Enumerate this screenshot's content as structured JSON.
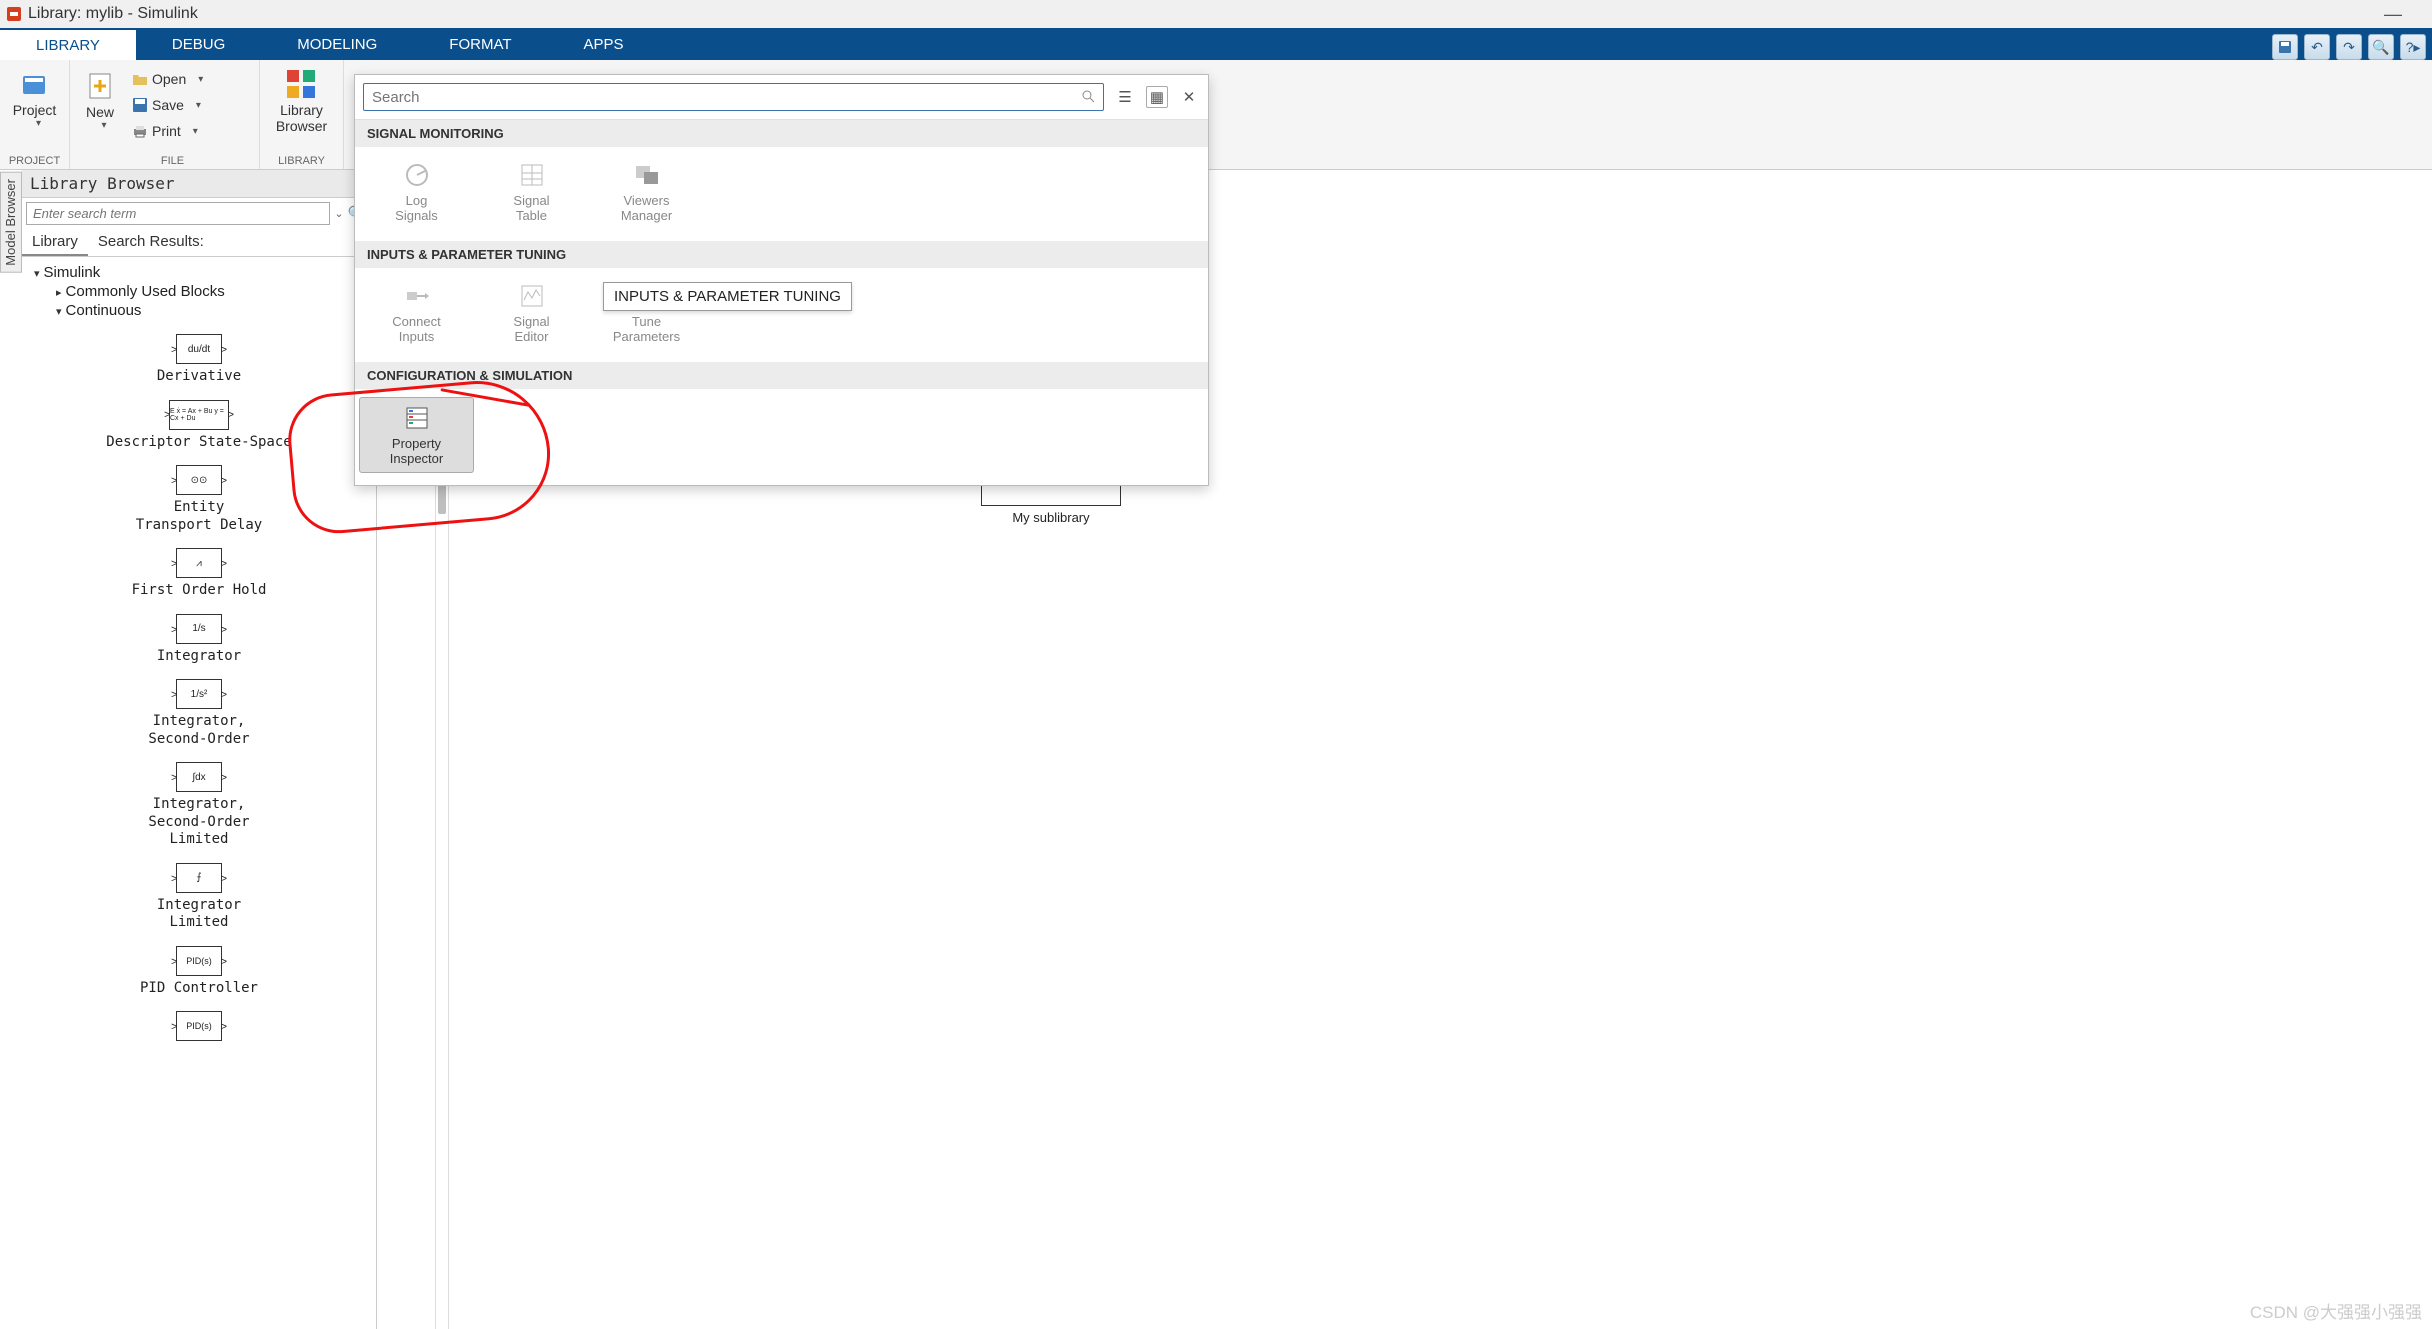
{
  "window": {
    "title": "Library: mylib - Simulink"
  },
  "tabs": [
    {
      "label": "LIBRARY",
      "active": true
    },
    {
      "label": "DEBUG",
      "active": false
    },
    {
      "label": "MODELING",
      "active": false
    },
    {
      "label": "FORMAT",
      "active": false
    },
    {
      "label": "APPS",
      "active": false
    }
  ],
  "ribbon": {
    "project": {
      "label": "Project",
      "group": "PROJECT"
    },
    "new": {
      "label": "New"
    },
    "open": {
      "label": "Open"
    },
    "save": {
      "label": "Save"
    },
    "print": {
      "label": "Print"
    },
    "file_group": "FILE",
    "library_browser": {
      "l1": "Library",
      "l2": "Browser",
      "group": "LIBRARY"
    }
  },
  "model_browser_tab": "Model Browser",
  "lib_browser": {
    "title": "Library Browser",
    "search_placeholder": "Enter search term",
    "tabs": {
      "library": "Library",
      "results": "Search Results:"
    },
    "tree": {
      "root": "Simulink",
      "n1": "Commonly Used Blocks",
      "n2": "Continuous"
    },
    "blocks": [
      {
        "icon": "du/dt",
        "label": "Derivative"
      },
      {
        "icon": "E ẋ = Ax + Bu\ny = Cx + Du",
        "label": "Descriptor State-Space"
      },
      {
        "icon": "⊙⊙",
        "label": "Entity\nTransport Delay"
      },
      {
        "icon": "⩘",
        "label": "First Order Hold"
      },
      {
        "icon": "1/s",
        "label": "Integrator"
      },
      {
        "icon": "1/s²",
        "label": "Integrator,\nSecond-Order"
      },
      {
        "icon": "∫dx",
        "label": "Integrator,\nSecond-Order\nLimited"
      },
      {
        "icon": "⨍",
        "label": "Integrator\nLimited"
      },
      {
        "icon": "PID(s)",
        "label": "PID Controller"
      },
      {
        "icon": "PID(s)",
        "label": ""
      }
    ]
  },
  "apps_dropdown": {
    "search_placeholder": "Search",
    "sections": [
      {
        "title": "SIGNAL MONITORING",
        "items": [
          {
            "l1": "Log",
            "l2": "Signals",
            "enabled": false
          },
          {
            "l1": "Signal",
            "l2": "Table",
            "enabled": false
          },
          {
            "l1": "Viewers",
            "l2": "Manager",
            "enabled": false
          }
        ]
      },
      {
        "title": "INPUTS & PARAMETER TUNING",
        "tooltip": "INPUTS & PARAMETER TUNING",
        "items": [
          {
            "l1": "Connect",
            "l2": "Inputs",
            "enabled": false
          },
          {
            "l1": "Signal",
            "l2": "Editor",
            "enabled": false
          },
          {
            "l1": "Tune",
            "l2": "Parameters",
            "enabled": false
          }
        ]
      },
      {
        "title": "CONFIGURATION & SIMULATION",
        "items": [
          {
            "l1": "Property",
            "l2": "Inspector",
            "enabled": true,
            "selected": true
          }
        ]
      }
    ]
  },
  "canvas": {
    "block_label": "My sublibrary"
  },
  "watermark": "CSDN @大强强小强强"
}
